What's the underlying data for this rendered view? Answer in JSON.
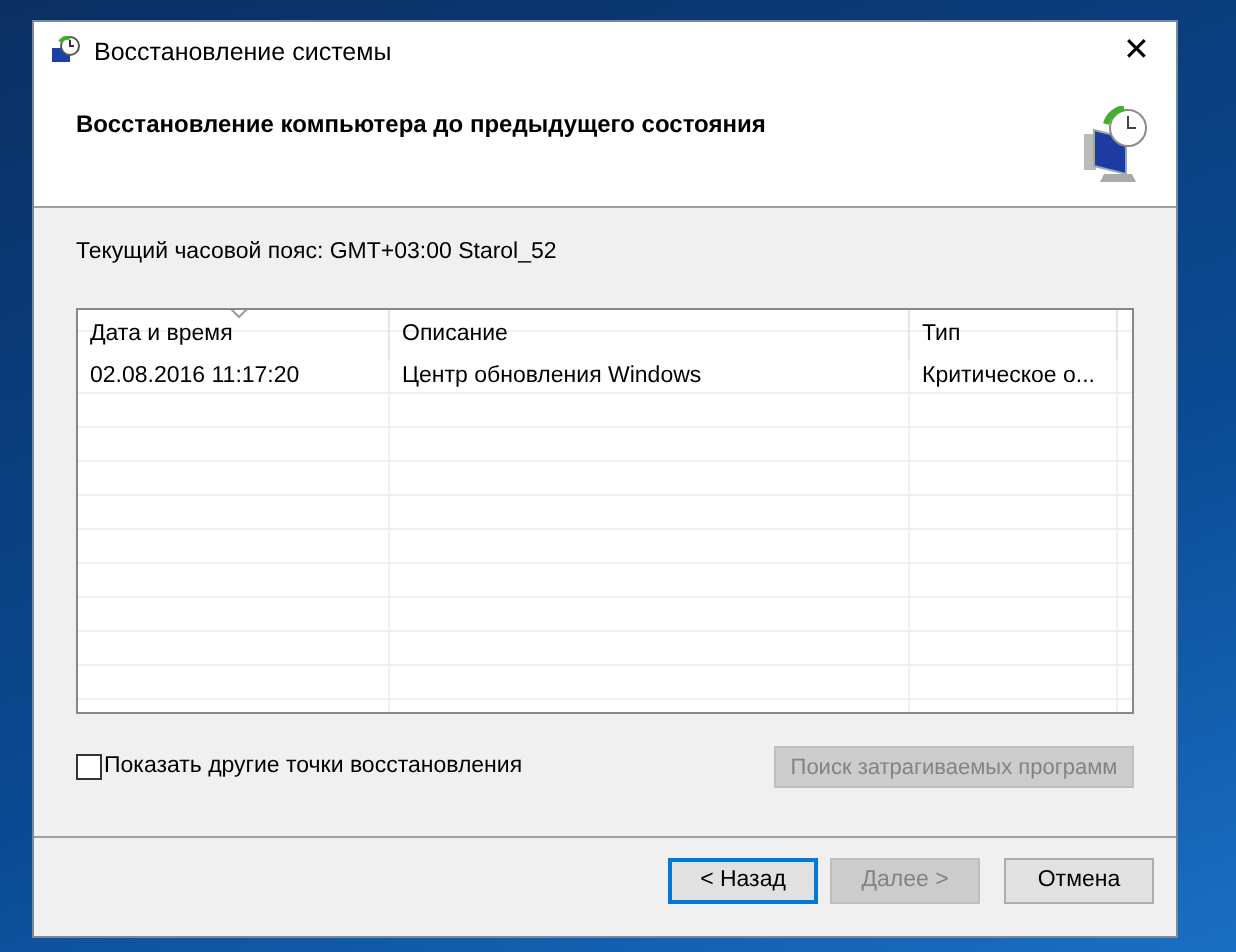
{
  "window": {
    "title": "Восстановление системы",
    "close_glyph": "✕"
  },
  "header": {
    "title": "Восстановление компьютера до предыдущего состояния"
  },
  "timezone": "Текущий часовой пояс: GMT+03:00 Starol_52",
  "table": {
    "columns": [
      {
        "label": "Дата и время",
        "sorted": true
      },
      {
        "label": "Описание",
        "sorted": false
      },
      {
        "label": "Тип",
        "sorted": false
      }
    ],
    "rows": [
      {
        "cells": [
          "02.08.2016 11:17:20",
          "Центр обновления Windows",
          "Критическое о..."
        ],
        "selected": false
      }
    ]
  },
  "show_more": {
    "label": "Показать другие точки восстановления",
    "checked": false
  },
  "scan_button": {
    "label": "Поиск затрагиваемых программ",
    "disabled": true
  },
  "buttons": [
    {
      "label": "< Назад",
      "disabled": false,
      "focused": true
    },
    {
      "label": "Далее >",
      "disabled": true,
      "focused": false
    },
    {
      "label": "Отмена",
      "disabled": false,
      "focused": false
    }
  ]
}
